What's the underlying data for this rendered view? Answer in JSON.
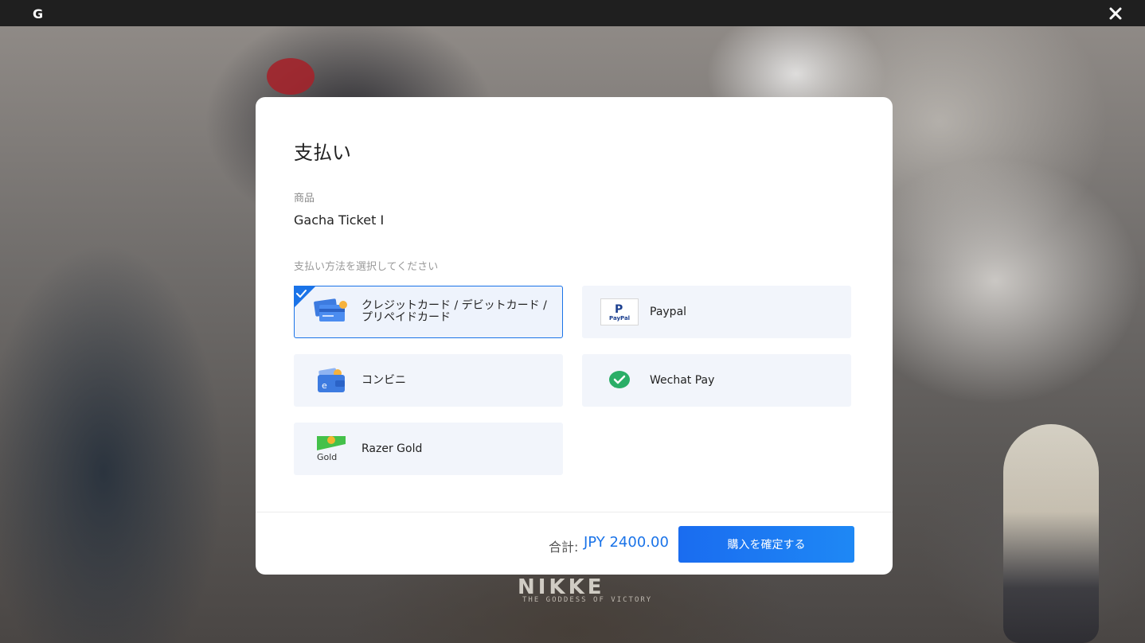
{
  "titlebar": {
    "logo_letter": "G",
    "close_glyph": "✕"
  },
  "background": {
    "title_mark": "NIKKE",
    "subtitle": "THE GODDESS OF VICTORY"
  },
  "modal": {
    "title": "支払い",
    "product_label": "商品",
    "product_name": "Gacha Ticket Ⅰ",
    "methods_label": "支払い方法を選択してください",
    "methods": [
      {
        "label": "クレジットカード / デビットカード / プリペイドカード",
        "icon": "credit-card-icon",
        "selected": true
      },
      {
        "label": "Paypal",
        "icon": "paypal-icon",
        "selected": false
      },
      {
        "label": "コンビニ",
        "icon": "wallet-icon",
        "selected": false
      },
      {
        "label": "Wechat Pay",
        "icon": "wechat-icon",
        "selected": false
      },
      {
        "label": "Razer Gold",
        "icon": "razer-gold-icon",
        "selected": false,
        "icon_text": "Gold"
      }
    ],
    "paypal_icon_text": "PayPal",
    "footer": {
      "total_label": "合計:",
      "total_value": "JPY 2400.00",
      "confirm_label": "購入を確定する"
    }
  },
  "colors": {
    "accent": "#1a73e8",
    "method_bg": "#f2f5fb",
    "wechat_green": "#2aae67"
  }
}
